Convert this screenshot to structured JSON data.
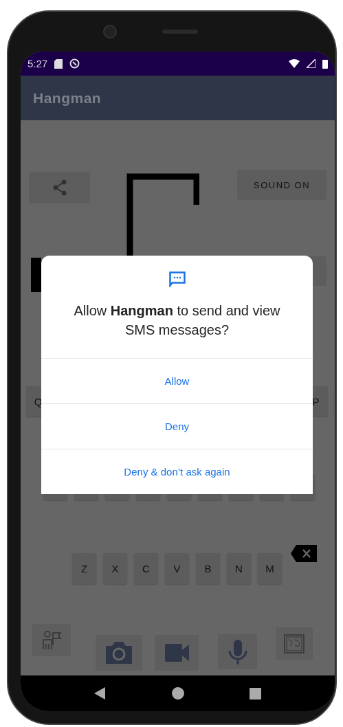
{
  "status_bar": {
    "time": "5:27"
  },
  "app_bar": {
    "title": "Hangman"
  },
  "game": {
    "sound_button": "SOUND ON"
  },
  "keyboard": {
    "top_row": [
      "Q",
      "P"
    ],
    "bottom_row": [
      "Z",
      "X",
      "C",
      "V",
      "B",
      "N",
      "M"
    ]
  },
  "permission_dialog": {
    "message": "Allow **Hangman** to send and view SMS messages?",
    "buttons": [
      "Allow",
      "Deny",
      "Deny & don’t ask again"
    ]
  }
}
